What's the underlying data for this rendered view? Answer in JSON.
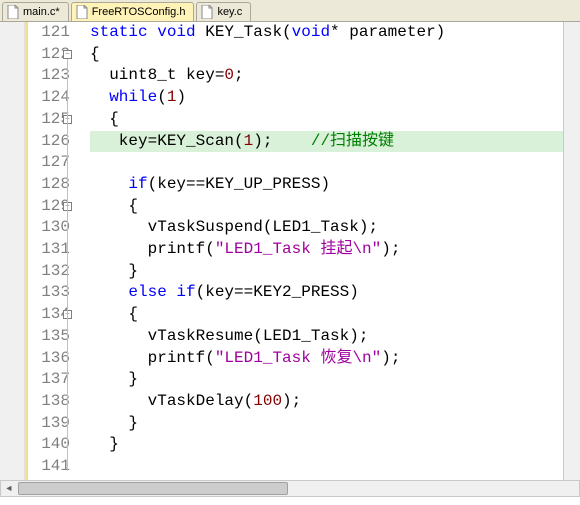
{
  "tabs": [
    {
      "label": "main.c*",
      "active": false
    },
    {
      "label": "FreeRTOSConfig.h",
      "active": true
    },
    {
      "label": "key.c",
      "active": false
    }
  ],
  "first_line": 121,
  "highlight_line": 126,
  "lines": [
    {
      "n": 121,
      "html": "<span class='kw'>static</span> <span class='kw'>void</span> KEY_Task(<span class='kw'>void</span>* parameter)"
    },
    {
      "n": 122,
      "html": "{",
      "fold": true
    },
    {
      "n": 123,
      "html": "  uint8_t key=<span class='num'>0</span>;"
    },
    {
      "n": 124,
      "html": "  <span class='kw'>while</span>(<span class='num'>1</span>)"
    },
    {
      "n": 125,
      "html": "  {",
      "fold": true
    },
    {
      "n": 126,
      "html": "   key=KEY_Scan(<span class='num'>1</span>);    <span class='cmt'>//扫描按键</span>"
    },
    {
      "n": 127,
      "html": ""
    },
    {
      "n": 128,
      "html": "    <span class='kw'>if</span>(key==KEY_UP_PRESS)"
    },
    {
      "n": 129,
      "html": "    {",
      "fold": true
    },
    {
      "n": 130,
      "html": "      vTaskSuspend(LED1_Task);"
    },
    {
      "n": 131,
      "html": "      printf(<span class='str'>\"LED1_Task 挂起\\n\"</span>);"
    },
    {
      "n": 132,
      "html": "    }"
    },
    {
      "n": 133,
      "html": "    <span class='kw'>else</span> <span class='kw'>if</span>(key==KEY2_PRESS)"
    },
    {
      "n": 134,
      "html": "    {",
      "fold": true
    },
    {
      "n": 135,
      "html": "      vTaskResume(LED1_Task);"
    },
    {
      "n": 136,
      "html": "      printf(<span class='str'>\"LED1_Task 恢复\\n\"</span>);"
    },
    {
      "n": 137,
      "html": "    }"
    },
    {
      "n": 138,
      "html": "      vTaskDelay(<span class='num'>100</span>);"
    },
    {
      "n": 139,
      "html": "    }"
    },
    {
      "n": 140,
      "html": "  }"
    },
    {
      "n": 141,
      "html": ""
    }
  ]
}
